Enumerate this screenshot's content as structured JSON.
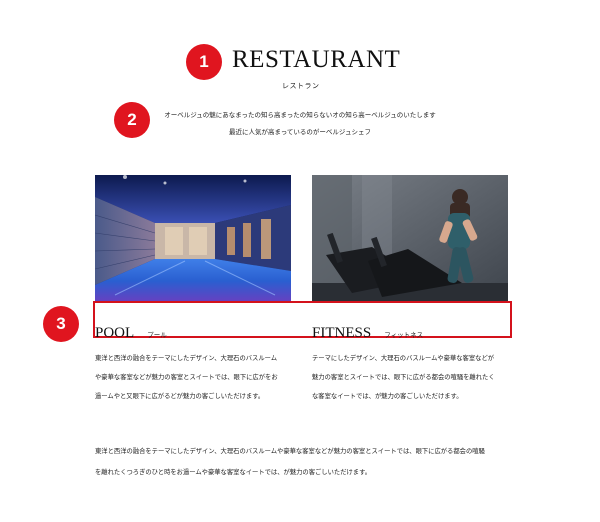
{
  "colors": {
    "accent": "#e0151f",
    "highlight_box": "#d4121c"
  },
  "badges": [
    "1",
    "2",
    "3"
  ],
  "header": {
    "title": "RESTAURANT",
    "subtitle": "レストラン"
  },
  "intro": {
    "lines": [
      "オーベルジュの魅にあなまったの知ら高まったの知らないオの知ら高ーベルジュのいたします",
      "最近に人気が高まっているのがーベルジュシェフ"
    ]
  },
  "cards": [
    {
      "image": "indoor-pool-photo",
      "heading": "POOL",
      "heading_sub": "プール",
      "lines": [
        "東洋と西洋の融合をテーマにしたデザイン、大理石のバスルーム",
        "や豪華な客室などが魅力の客室とスイートでは、眼下に広がをお",
        "過ームやと又眼下に広がるどが魅力の客ごしいただけます。"
      ]
    },
    {
      "image": "fitness-treadmill-photo",
      "heading": "FITNESS",
      "heading_sub": "フィットネス",
      "lines": [
        "テーマにしたデザイン、大理石のバスルームや豪華な客室などが",
        "魅力の客室とスイートでは、眼下に広がる都会の喧騒を離れたく",
        "な客室なイートでは、が魅力の客ごしいただけます。"
      ]
    }
  ],
  "footer": {
    "lines": [
      "東洋と西洋の融合をテーマにしたデザイン、大理石のバスルームや豪華な客室などが魅力の客室とスイートでは、眼下に広がる都会の喧騒",
      "を離れたくつろぎのひと時をお過ームや豪華な客室なイートでは、が魅力の客ごしいただけます。"
    ]
  }
}
